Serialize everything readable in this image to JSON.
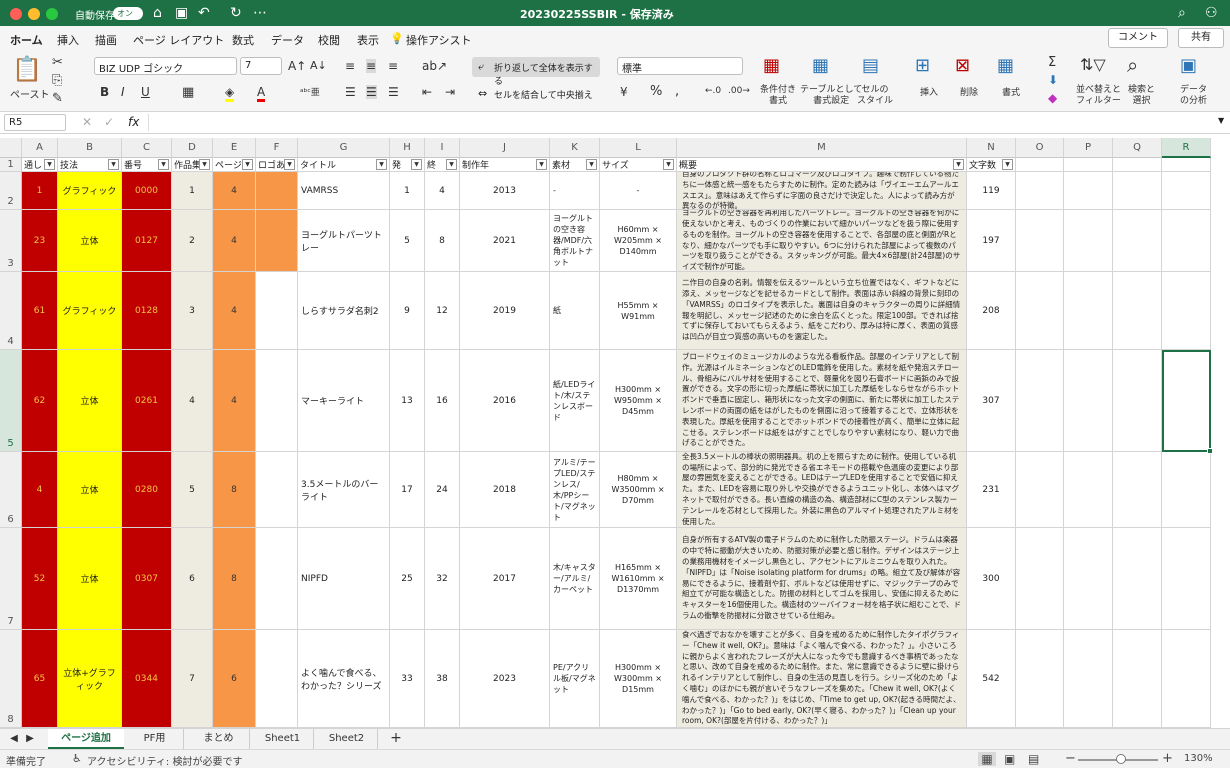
{
  "titlebar": {
    "autosave_label": "自動保存",
    "autosave_state": "オン",
    "title": "20230225SSBIR - 保存済み"
  },
  "ribbon_tabs": [
    {
      "label": "ホーム",
      "active": true
    },
    {
      "label": "挿入"
    },
    {
      "label": "描画"
    },
    {
      "label": "ページ レイアウト"
    },
    {
      "label": "数式"
    },
    {
      "label": "データ"
    },
    {
      "label": "校閲"
    },
    {
      "label": "表示"
    },
    {
      "label": "操作アシスト"
    }
  ],
  "comment_button": "コメント",
  "share_button": "共有",
  "ribbon": {
    "paste": "ペースト",
    "font_name": "BIZ UDP ゴシック",
    "font_size": "7",
    "wrap_text": "折り返して全体を表示する",
    "merge_center": "セルを結合して中央揃え",
    "number_format": "標準",
    "conditional_format": "条件付き\n書式",
    "format_as_table": "テーブルとして\n書式設定",
    "cell_styles": "セルの\nスタイル",
    "insert": "挿入",
    "delete": "削除",
    "format": "書式",
    "sort_filter": "並べ替えと\nフィルター",
    "find_select": "検索と\n選択",
    "analyze": "データ\nの分析"
  },
  "formula_bar": {
    "name_box": "R5",
    "fx": "fx",
    "value": ""
  },
  "columns": [
    "A",
    "B",
    "C",
    "D",
    "E",
    "F",
    "G",
    "H",
    "I",
    "J",
    "K",
    "L",
    "M",
    "N",
    "O",
    "P",
    "Q",
    "R"
  ],
  "header_row": {
    "number": "1",
    "cells": [
      "通し",
      "技法",
      "番号",
      "作品集通",
      "ページ",
      "ロゴあり",
      "タイトル",
      "発",
      "終",
      "制作年",
      "素材",
      "サイズ",
      "概要",
      "文字数",
      "",
      "",
      "",
      ""
    ]
  },
  "rows": [
    {
      "num": "2",
      "cells": [
        "1",
        "グラフィック",
        "0000",
        "1",
        "4",
        "",
        "VAMRSS",
        "1",
        "4",
        "2013",
        "-",
        "-",
        "自身のプロダクト群の名称とロゴマーク及びロゴタイプ。趣味で制作している物たちに一体感と統一感をもたらすために制作。定めた読みは「ヴイエーエムアールエスエス」。意味はあえて作らずに字面の良さだけで決定した。人によって読み方が異なるのが特徴。",
        "119",
        "",
        "",
        "",
        ""
      ]
    },
    {
      "num": "3",
      "cells": [
        "23",
        "立体",
        "0127",
        "2",
        "4",
        "",
        "ヨーグルトパーツトレー",
        "5",
        "8",
        "2021",
        "ヨーグルトの空き容器/MDF/六角ボルトナット",
        "H60mm × W205mm × D140mm",
        "ヨーグルトの空き容器を再利用したパーツトレー。ヨーグルトの空き容器を何かに使えないかと考え、ものづくりの作業において細かいパーツなどを扱う際に使用するものを制作。ヨーグルトの空き容器を使用することで、各部屋の底と側面がRとなり、細かなパーツでも手に取りやすい。6つに分けられた部屋によって複数のパーツを取り扱うことができる。スタッキングが可能。最大4×6部屋(計24部屋)のサイズで制作が可能。",
        "197",
        "",
        "",
        "",
        ""
      ]
    },
    {
      "num": "4",
      "cells": [
        "61",
        "グラフィック",
        "0128",
        "3",
        "4",
        "",
        "しらすサラダ名刺2",
        "9",
        "12",
        "2019",
        "紙",
        "H55mm × W91mm",
        "二作目の自身の名刺。情報を伝えるツールという立ち位置ではなく、ギフトなどに添え、メッセージなどを記せるカードとして制作。表面は赤い斜線の背景に刻印の「VAMRSS」のロゴタイプを表示した。裏面は自身のキャラクターの周りに詳細情報を明記し、メッセージ記述のために余白を広くとった。限定100部。できれば捨てずに保存しておいてもらえるよう、紙をこだわり、厚みは特に厚く、表面の質感は凹凸が目立つ質感の高いものを選定した。",
        "208",
        "",
        "",
        "",
        ""
      ]
    },
    {
      "num": "5",
      "cells": [
        "62",
        "立体",
        "0261",
        "4",
        "4",
        "",
        "マーキーライト",
        "13",
        "16",
        "2016",
        "紙/LEDライト/木/ステンレスボード",
        "H300mm × W950mm × D45mm",
        "ブロードウェイのミュージカルのような光る看板作品。部屋のインテリアとして制作。光源はイルミネーションなどのLED電飾を使用した。素材を紙や発泡スチロール、骨組みにバルサ材を使用することで、軽量化を図り石膏ボードに画鋲のみで設置ができる。文字の形に切った厚紙に帯状に加工した厚紙をしならせながらホットボンドで垂直に固定し、箱形状になった文字の側面に、新たに帯状に加工したステレンボードの両面の紙をはがしたものを側面に沿って接着することで、立体形状を表現した。厚紙を使用することでホットボンドでの接着性が高く、簡単に立体に起こせる。ステレンボードは紙をはがすことでしなりやすい素材になり、軽い力で曲げることができた。",
        "307",
        "",
        "",
        "",
        ""
      ]
    },
    {
      "num": "6",
      "cells": [
        "4",
        "立体",
        "0280",
        "5",
        "8",
        "",
        "3.5メートルのバーライト",
        "17",
        "24",
        "2018",
        "アルミ/テープLED/ステンレス/木/PPシート/マグネット",
        "H80mm × W3500mm × D70mm",
        "全長3.5メートルの棒状の照明器具。机の上を照らすために制作。使用している机の場所によって、部分的に発光できる省エネモードの搭載や色温度の変更により部屋の雰囲気を変えることができる。LEDはテープLEDを使用することで安価に抑えた。また、LEDを容易に取り外しや交換ができるようユニット化し、本体へはマグネットで取付ができる。長い直線の構造の為、構造部材にC型のステンレス製カーテンレールを芯材として採用した。外装に黒色のアルマイト処理されたアルミ材を使用した。",
        "231",
        "",
        "",
        "",
        ""
      ]
    },
    {
      "num": "7",
      "cells": [
        "52",
        "立体",
        "0307",
        "6",
        "8",
        "",
        "NIPFD",
        "25",
        "32",
        "2017",
        "木/キャスター/アルミ/カーペット",
        "H165mm × W1610mm × D1370mm",
        "自身が所有するATV製の電子ドラムのために制作した防振ステージ。ドラムは楽器の中で特に振動が大きいため、防振対策が必要と感じ制作。デザインはステージ上の業務用機材をイメージし黒色とし、アクセントにアルミニウムを取り入れた。「NIPFD」は「Noise isolating platform for drums」の略。組立て及び解体が容易にできるように、接着剤や釘、ボルトなどは使用せずに、マジックテープのみで組立てが可能な構造とした。防振の材料としてゴムを採用し、安価に抑えるためにキャスターを16個使用した。構造材のツーバイフォー材を格子状に組むことで、ドラムの衝撃を防振材に分散させている仕組み。",
        "300",
        "",
        "",
        "",
        ""
      ]
    },
    {
      "num": "8",
      "cells": [
        "65",
        "立体+グラフィック",
        "0344",
        "7",
        "6",
        "",
        "よく噛んで食べる、わかった？シリーズ",
        "33",
        "38",
        "2023",
        "PE/アクリル板/マグネット",
        "H300mm × W300mm × D15mm",
        "食べ過ぎでおなかを壊すことが多く、自身を戒めるために制作したタイポグラフィー「Chew it well, OK?」。意味は「よく噛んで食べる、わかった？」。小さいころに親からよく言われたフレーズが大人になった今でも意識するべき事柄であったなと思い、改めて自身を戒めるために制作。また、常に意識できるように壁に掛けられるインテリアとして制作し、自身の生活の見直しを行う。シリーズ化のため「よく噛む」のほかにも親が言いそうなフレーズを集めた。「Chew it well, OK?(よく噛んで食べる、わかった？)」をはじめ、「Time to get up, OK?(起きる時間だよ、わかった？)」「Go to bed early, OK?(早く寝る、わかった？)」「Clean up your room, OK?(部屋を片付ける、わかった？)」",
        "542",
        "",
        "",
        "",
        ""
      ]
    }
  ],
  "sheet_tabs": [
    {
      "label": "ページ追加",
      "active": true
    },
    {
      "label": "PF用"
    },
    {
      "label": "まとめ"
    },
    {
      "label": "Sheet1"
    },
    {
      "label": "Sheet2"
    }
  ],
  "status": {
    "ready": "準備完了",
    "accessibility": "アクセシビリティ: 検討が必要です",
    "zoom": "130%"
  },
  "colors": {
    "brand": "#1e7145",
    "col_a": "#c00000",
    "col_b": "#ffff00",
    "col_c": "#c00000",
    "col_d": "#eeece1",
    "col_e": "#f79646",
    "col_m": "#eeece1",
    "selection": "#1e7145"
  }
}
